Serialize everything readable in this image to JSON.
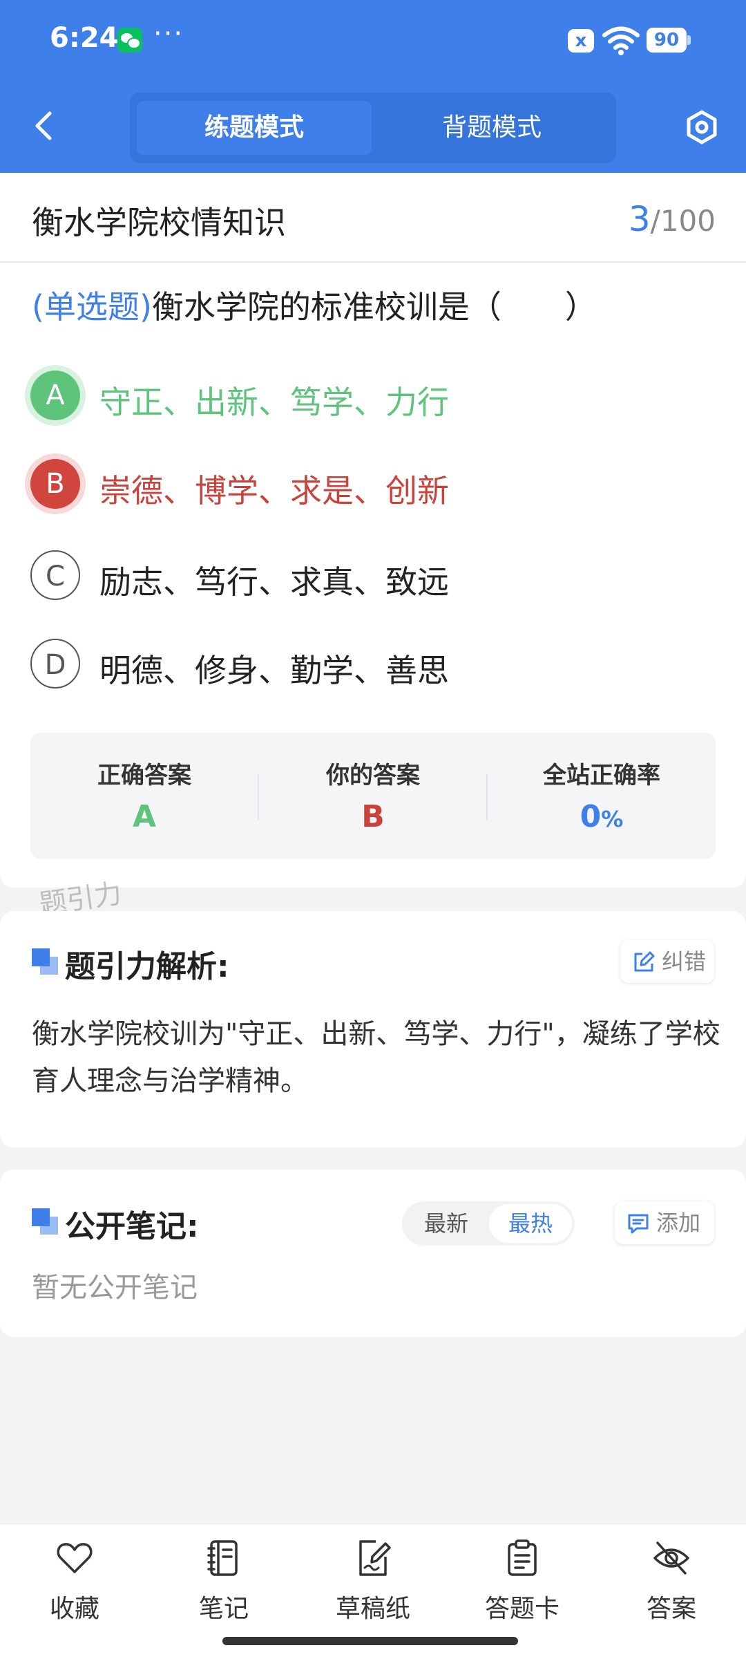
{
  "status_bar": {
    "time": "6:24",
    "dots": "···",
    "battery": "90",
    "sim_icon": "x"
  },
  "header": {
    "tabs": [
      {
        "label": "练题模式",
        "active": true
      },
      {
        "label": "背题模式",
        "active": false
      }
    ]
  },
  "question": {
    "category": "衡水学院校情知识",
    "current": "3",
    "total": "/100",
    "type": "(单选题)",
    "stem": "衡水学院的标准校训是（　　）",
    "options": [
      {
        "letter": "A",
        "text": "守正、出新、笃学、力行",
        "state": "correct"
      },
      {
        "letter": "B",
        "text": "崇德、博学、求是、创新",
        "state": "wrong"
      },
      {
        "letter": "C",
        "text": "励志、笃行、求真、致远",
        "state": "normal"
      },
      {
        "letter": "D",
        "text": "明德、修身、勤学、善思",
        "state": "normal"
      }
    ],
    "stats": {
      "correct_label": "正确答案",
      "correct_value": "A",
      "yours_label": "你的答案",
      "yours_value": "B",
      "rate_label": "全站正确率",
      "rate_value": "0",
      "rate_unit": "%"
    },
    "watermark": "题引力"
  },
  "analysis": {
    "title": "题引力解析:",
    "report_label": "纠错",
    "text": "衡水学院校训为\"守正、出新、笃学、力行\"，凝练了学校育人理念与治学精神。"
  },
  "notes": {
    "title": "公开笔记:",
    "sort_options": [
      "最新",
      "最热"
    ],
    "active_sort": "最热",
    "add_label": "添加",
    "empty_text": "暂无公开笔记"
  },
  "bottom_nav": [
    {
      "label": "收藏",
      "icon": "heart-icon"
    },
    {
      "label": "笔记",
      "icon": "notebook-icon"
    },
    {
      "label": "草稿纸",
      "icon": "draft-icon"
    },
    {
      "label": "答题卡",
      "icon": "clipboard-icon"
    },
    {
      "label": "答案",
      "icon": "eye-off-icon"
    }
  ],
  "colors": {
    "primary": "#3f7fe9",
    "correct": "#5ec37b",
    "wrong": "#c8433c"
  }
}
